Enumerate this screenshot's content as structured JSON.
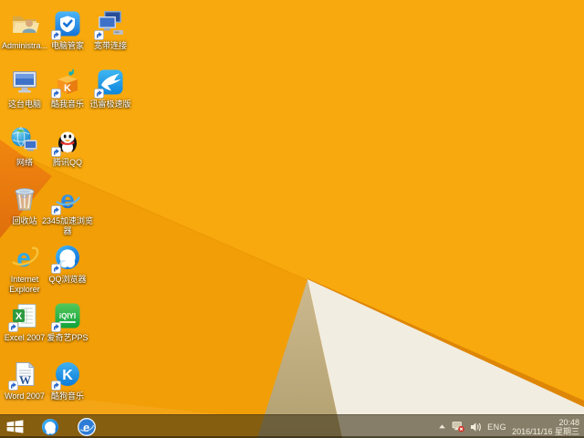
{
  "wallpaper": {
    "colors": {
      "base": "#F29E06",
      "upper_fold": "#F8A90D",
      "left_wedge_top": "#F1860F",
      "left_wedge_bottom": "#DF6F0C",
      "fold_shadow": "#DE8606",
      "tan_triangle_top": "#CCB98E",
      "tan_triangle_bottom": "#B2A070",
      "cream_triangle": "#F2EDE1"
    }
  },
  "desktop": {
    "icons": [
      {
        "type": "user-folder",
        "label": "Administra...",
        "shortcut": false,
        "row": 0,
        "col": 0
      },
      {
        "type": "pc-manager",
        "label": "电脑管家",
        "shortcut": true,
        "row": 0,
        "col": 1
      },
      {
        "type": "broadband",
        "label": "宽带连接",
        "shortcut": true,
        "row": 0,
        "col": 2
      },
      {
        "type": "this-pc",
        "label": "这台电脑",
        "shortcut": false,
        "row": 1,
        "col": 0
      },
      {
        "type": "kuwo-music",
        "label": "酷我音乐",
        "shortcut": true,
        "row": 1,
        "col": 1
      },
      {
        "type": "xunlei",
        "label": "迅雷极速版",
        "shortcut": true,
        "row": 1,
        "col": 2
      },
      {
        "type": "network",
        "label": "网络",
        "shortcut": false,
        "row": 2,
        "col": 0
      },
      {
        "type": "qq",
        "label": "腾讯QQ",
        "shortcut": true,
        "row": 2,
        "col": 1
      },
      {
        "type": "recycle-bin",
        "label": "回收站",
        "shortcut": false,
        "row": 3,
        "col": 0
      },
      {
        "type": "e-2345",
        "label": "2345加速浏览器",
        "shortcut": true,
        "row": 3,
        "col": 1
      },
      {
        "type": "internet-explorer",
        "label": "Internet Explorer",
        "shortcut": false,
        "row": 4,
        "col": 0
      },
      {
        "type": "qq-browser",
        "label": "QQ浏览器",
        "shortcut": true,
        "row": 4,
        "col": 1
      },
      {
        "type": "excel",
        "label": "Excel 2007",
        "shortcut": true,
        "row": 5,
        "col": 0
      },
      {
        "type": "iqiyi-pps",
        "label": "爱奇艺PPS",
        "shortcut": true,
        "row": 5,
        "col": 1
      },
      {
        "type": "word",
        "label": "Word 2007",
        "shortcut": true,
        "row": 6,
        "col": 0
      },
      {
        "type": "kugou-music",
        "label": "酷狗音乐",
        "shortcut": true,
        "row": 6,
        "col": 1
      }
    ]
  },
  "taskbar": {
    "apps": [
      {
        "type": "qq-browser-task",
        "name": "qq-browser"
      },
      {
        "type": "ie-task",
        "name": "internet-explorer"
      }
    ],
    "tray": {
      "language": "ENG",
      "time": "20:48",
      "date": "2016/11/16 星期三"
    }
  }
}
